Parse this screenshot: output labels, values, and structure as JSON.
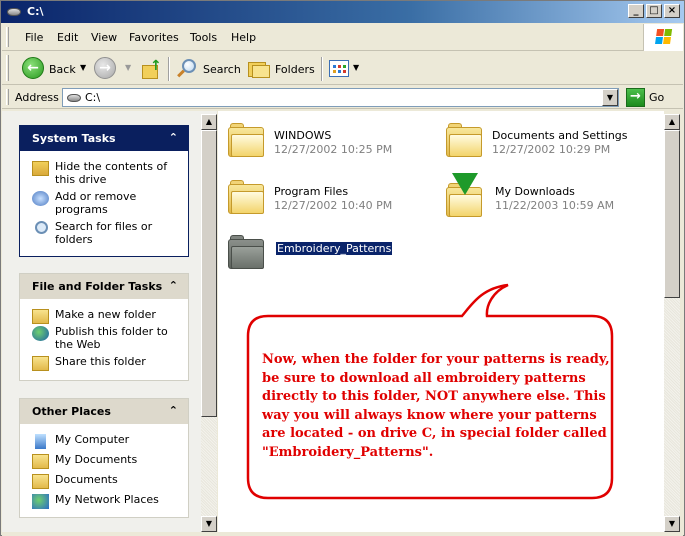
{
  "window": {
    "title": "C:\\",
    "controls": {
      "minimize": "_",
      "maximize": "□",
      "close": "×"
    }
  },
  "menu": [
    "File",
    "Edit",
    "View",
    "Favorites",
    "Tools",
    "Help"
  ],
  "toolbar": {
    "back_label": "Back",
    "search_label": "Search",
    "folders_label": "Folders",
    "icons": [
      "back-arrow-icon",
      "forward-arrow-icon",
      "up-folder-icon",
      "search-magnifier-icon",
      "folders-icon",
      "views-icon"
    ]
  },
  "address": {
    "label": "Address",
    "value": "C:\\",
    "go_label": "Go"
  },
  "sidebar": {
    "panels": [
      {
        "title": "System Tasks",
        "items": [
          {
            "label": "Hide the contents of this drive",
            "icon": "hide-contents-icon"
          },
          {
            "label": "Add or remove programs",
            "icon": "add-remove-programs-icon"
          },
          {
            "label": "Search for files or folders",
            "icon": "search-icon"
          }
        ]
      },
      {
        "title": "File and Folder Tasks",
        "items": [
          {
            "label": "Make a new folder",
            "icon": "new-folder-icon"
          },
          {
            "label": "Publish this folder to the Web",
            "icon": "publish-web-icon"
          },
          {
            "label": "Share this folder",
            "icon": "share-folder-icon"
          }
        ]
      },
      {
        "title": "Other Places",
        "items": [
          {
            "label": "My Computer",
            "icon": "my-computer-icon"
          },
          {
            "label": "My Documents",
            "icon": "my-documents-icon"
          },
          {
            "label": "Documents",
            "icon": "folder-icon"
          },
          {
            "label": "My Network Places",
            "icon": "network-places-icon"
          }
        ]
      }
    ]
  },
  "files": [
    {
      "name": "WINDOWS",
      "date": "12/27/2002 10:25 PM"
    },
    {
      "name": "Documents and Settings",
      "date": "12/27/2002 10:29 PM"
    },
    {
      "name": "Program Files",
      "date": "12/27/2002 10:40 PM"
    },
    {
      "name": "My Downloads",
      "date": "11/22/2003 10:59 AM"
    },
    {
      "name": "Embroidery_Patterns",
      "date": "",
      "selected": true
    }
  ],
  "callout": {
    "text": "Now, when the folder for your patterns is ready, be sure to download all embroidery patterns directly to this folder, NOT anywhere else. This way you will always know where your patterns are located - on drive C, in special folder called \"Embroidery_Patterns\".",
    "color": "#e00000"
  },
  "colors": {
    "selection": "#0a246a",
    "task_header_dark": "#0a1f5e",
    "task_header_light": "#ddd9cc"
  }
}
